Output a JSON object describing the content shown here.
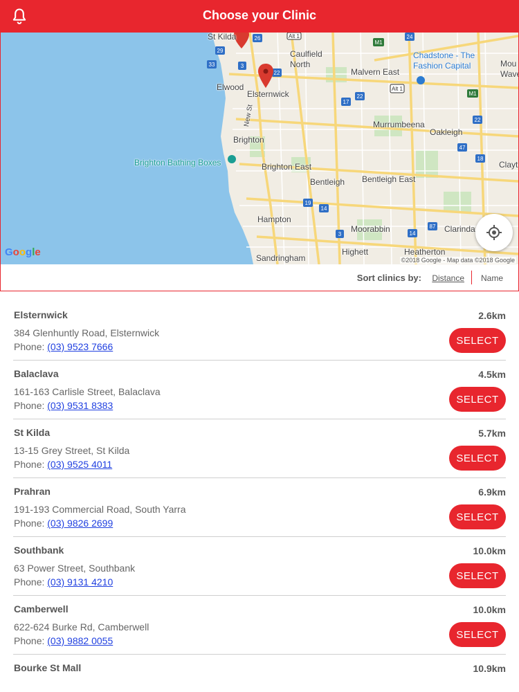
{
  "header": {
    "title": "Choose your Clinic",
    "icon": "bell-icon"
  },
  "map": {
    "labels": {
      "st_kilda": "St Kilda",
      "caulfield_north": "Caulfield\nNorth",
      "chadstone": "Chadstone - The\nFashion Capital",
      "malvern_east": "Malvern East",
      "elwood": "Elwood",
      "elsternwick": "Elsternwick",
      "new_st": "New St",
      "murrumbeena": "Murrumbeena",
      "oakleigh": "Oakleigh",
      "brighton": "Brighton",
      "brighton_bathing": "Brighton Bathing Boxes",
      "brighton_east": "Brighton East",
      "bentleigh": "Bentleigh",
      "bentleigh_east": "Bentleigh East",
      "clayton": "Claytı",
      "hampton": "Hampton",
      "moorabbin": "Moorabbin",
      "clarinda": "Clarinda",
      "highett": "Highett",
      "heatherton": "Heatherton",
      "sandringham": "Sandringham",
      "mount_waverley": "Mou\nWave"
    },
    "google_logo": "Google",
    "attribution": "©2018 Google - Map data ©2018 Google",
    "locate_icon": "crosshair-icon"
  },
  "sort": {
    "label": "Sort clinics by:",
    "distance": "Distance",
    "name": "Name"
  },
  "clinics": [
    {
      "name": "Elsternwick",
      "distance": "2.6km",
      "address": "384 Glenhuntly Road, Elsternwick",
      "phone_prefix": "Phone: ",
      "phone": "(03) 9523 7666",
      "select": "SELECT"
    },
    {
      "name": "Balaclava",
      "distance": "4.5km",
      "address": "161-163 Carlisle Street, Balaclava",
      "phone_prefix": "Phone: ",
      "phone": "(03) 9531 8383",
      "select": "SELECT"
    },
    {
      "name": "St Kilda",
      "distance": "5.7km",
      "address": "13-15 Grey Street, St Kilda",
      "phone_prefix": "Phone: ",
      "phone": "(03) 9525 4011",
      "select": "SELECT"
    },
    {
      "name": "Prahran",
      "distance": "6.9km",
      "address": "191-193 Commercial Road, South Yarra",
      "phone_prefix": "Phone: ",
      "phone": "(03) 9826 2699",
      "select": "SELECT"
    },
    {
      "name": "Southbank",
      "distance": "10.0km",
      "address": "63 Power Street, Southbank",
      "phone_prefix": "Phone: ",
      "phone": "(03) 9131 4210",
      "select": "SELECT"
    },
    {
      "name": "Camberwell",
      "distance": "10.0km",
      "address": "622-624 Burke Rd, Camberwell",
      "phone_prefix": "Phone: ",
      "phone": "(03) 9882 0055",
      "select": "SELECT"
    },
    {
      "name": "Bourke St Mall",
      "distance": "10.9km"
    }
  ],
  "colors": {
    "brand": "#e8262e",
    "link": "#1f3fe0",
    "water": "#8cc4ea",
    "land": "#f1ede4",
    "road": "#f7d77a"
  }
}
